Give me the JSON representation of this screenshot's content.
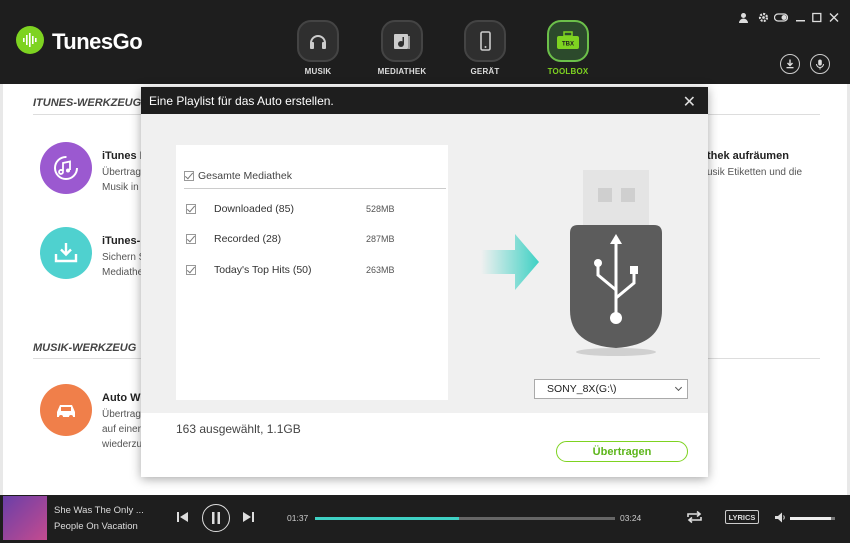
{
  "app": {
    "title": "TunesGo"
  },
  "nav": {
    "tabs": [
      {
        "label": "MUSIK",
        "icon": "headphones-icon"
      },
      {
        "label": "MEDIATHEK",
        "icon": "music-library-icon"
      },
      {
        "label": "GERÄT",
        "icon": "phone-icon"
      },
      {
        "label": "TOOLBOX",
        "icon": "toolbox-icon",
        "badge": "TBX",
        "active": true
      }
    ]
  },
  "sections": {
    "itunes": {
      "title": "ITUNES-WERKZEUG",
      "tools": [
        {
          "title": "iTunes M",
          "desc": [
            "Übertrag",
            "Musik in"
          ]
        },
        {
          "title": "iTunes-I",
          "desc": [
            "Sichern S",
            "Mediathe"
          ]
        }
      ],
      "right_tool": {
        "title": "thek aufräumen",
        "desc": [
          "usik Etiketten und die"
        ]
      }
    },
    "musik": {
      "title": "MUSIK-WERKZEUG",
      "tools": [
        {
          "title": "Auto W",
          "desc": [
            "Übertrag",
            "auf einer",
            "wiederzu"
          ]
        }
      ]
    }
  },
  "modal": {
    "title": "Eine Playlist für das Auto erstellen.",
    "header_checkbox_label": "Gesamte Mediathek",
    "playlists": [
      {
        "name": "Downloaded (85)",
        "size": "528MB"
      },
      {
        "name": "Recorded (28)",
        "size": "287MB"
      },
      {
        "name": "Today's Top Hits (50)",
        "size": "263MB"
      }
    ],
    "device": "SONY_8X(G:\\)",
    "summary": "163 ausgewählt, 1.1GB",
    "transfer_label": "Übertragen"
  },
  "player": {
    "track_title": "She Was The Only ...",
    "track_artist": "People On Vacation",
    "time_current": "01:37",
    "time_total": "03:24",
    "progress": 0.48,
    "volume": 0.9,
    "lyrics_label": "LYRICS"
  },
  "colors": {
    "accent": "#7ed321",
    "progress": "#3fd1c4",
    "topbar": "#1e1e1e"
  }
}
